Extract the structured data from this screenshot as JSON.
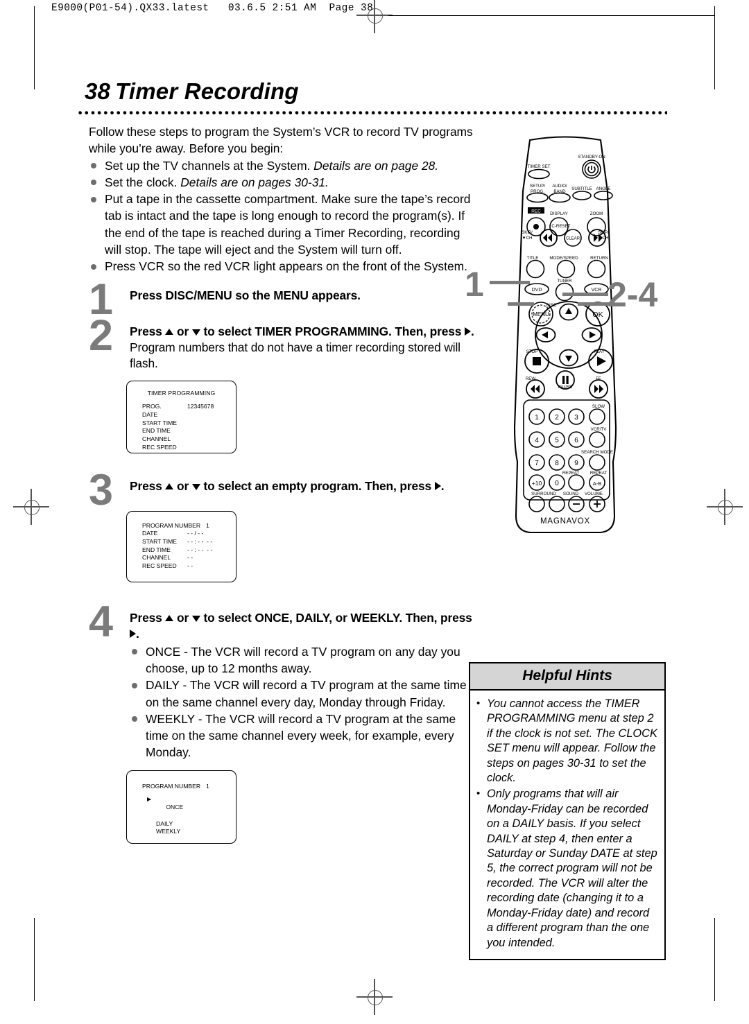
{
  "slug": "E9000(P01-54).QX33.latest   03.6.5 2:51 AM  Page 38",
  "title": {
    "number": "38",
    "text": "Timer Recording"
  },
  "intro": {
    "paragraph": "Follow these steps to program the System’s  VCR to record TV programs while you’re away. Before you begin:",
    "bullets": [
      {
        "text": "Set up the TV channels at the System. ",
        "italic": "Details are on page 28."
      },
      {
        "text": "Set the clock. ",
        "italic": "Details are on pages 30-31."
      },
      {
        "text": "Put a tape in the cassette compartment. Make sure the tape’s record tab is intact and the tape is long enough to record the program(s). If the end of the tape is reached during a Timer Recording, recording will stop. The tape will eject and the System will turn off.",
        "italic": ""
      },
      {
        "text": "Press VCR so the red VCR light appears on the front of the System.",
        "italic": ""
      }
    ]
  },
  "steps": [
    {
      "number": "1",
      "bold_a": "Press DISC/MENU so the MENU appears.",
      "regular_a": "",
      "bold_b": "",
      "regular_b": ""
    },
    {
      "number": "2",
      "bold_a": "Press ▲ or ▼ to select TIMER PROGRAMMING. Then, press ▶.",
      "regular_a": " Program numbers that do not have a timer recording stored will flash.",
      "bold_b": "",
      "regular_b": ""
    },
    {
      "number": "3",
      "bold_a": "Press ▲ or ▼ to select an empty program. Then, press ▶.",
      "regular_a": "",
      "bold_b": "",
      "regular_b": ""
    },
    {
      "number": "4",
      "bold_a": "Press ▲ or ▼ to select ONCE, DAILY, or WEEKLY. Then, press ▶.",
      "regular_a": "",
      "bold_b": "",
      "regular_b": ""
    }
  ],
  "step4_bullets": [
    "ONCE - The VCR will record a TV program on any day you choose, up to 12 months away.",
    "DAILY - The VCR will record a TV program at the same time on the same channel every day, Monday through Friday.",
    "WEEKLY - The VCR will record a TV program at the same time on the same channel every week, for example, every Monday."
  ],
  "osd": [
    {
      "title": "TIMER PROGRAMMING",
      "rows": [
        {
          "key": "PROG.",
          "value": "12345678"
        },
        {
          "key": "DATE",
          "value": ""
        },
        {
          "key": "START TIME",
          "value": ""
        },
        {
          "key": "END TIME",
          "value": ""
        },
        {
          "key": "CHANNEL",
          "value": ""
        },
        {
          "key": "REC SPEED",
          "value": ""
        }
      ],
      "options": []
    },
    {
      "title": "",
      "rows": [
        {
          "key": "PROGRAM NUMBER",
          "value": "1"
        },
        {
          "key": "DATE",
          "value": "- - / - -"
        },
        {
          "key": "START TIME",
          "value": "- - : - -  - -"
        },
        {
          "key": "END TIME",
          "value": "- - : - -  - -"
        },
        {
          "key": "CHANNEL",
          "value": "- -"
        },
        {
          "key": "REC SPEED",
          "value": "- -"
        }
      ],
      "options": []
    },
    {
      "title": "",
      "rows": [
        {
          "key": "PROGRAM NUMBER",
          "value": "1"
        }
      ],
      "options": [
        {
          "label": "ONCE",
          "selected": true
        },
        {
          "label": "DAILY",
          "selected": false
        },
        {
          "label": "WEEKLY",
          "selected": false
        }
      ]
    }
  ],
  "remote": {
    "brand": "MAGNAVOX",
    "callouts": [
      {
        "label": "1",
        "points_to": "DISC/MENU"
      },
      {
        "label": "2-4",
        "points_to": "navigation arrows"
      }
    ],
    "buttons": [
      "TIMER SET",
      "STANDBY-ON",
      "SETUP/ PROG.",
      "AUDIO/ BAND",
      "SUBTITLE",
      "ANGLE",
      "REC",
      "DISPLAY",
      "ZOOM",
      "SKIP/ ▼CH",
      "C-RESET CLEAR",
      "SKIP/ ▲CH",
      "TITLE",
      "MODE/SPEED",
      "RETURN",
      "TUNER",
      "DVD",
      "VCR",
      "DISC MENU",
      "OK",
      "STOP",
      "PLAY",
      "REW",
      "PAUSE",
      "FF",
      "1",
      "2",
      "3",
      "SLOW",
      "4",
      "5",
      "6",
      "VCR/TV",
      "7",
      "8",
      "9",
      "SEARCH MODE",
      "+10",
      "0",
      "REPEAT",
      "REPEAT A-B",
      "SURROUND",
      "SOUND",
      "VOLUME"
    ],
    "labels": {
      "timer_set": "TIMER SET",
      "standby_on": "STANDBY-ON",
      "setup_prog": "SETUP/",
      "setup_prog2": "PROG.",
      "audio_band": "AUDIO/",
      "audio_band2": "BAND",
      "subtitle": "SUBTITLE",
      "angle": "ANGLE",
      "rec": "REC",
      "display": "DISPLAY",
      "zoom": "ZOOM",
      "skip_down": "SKIP/",
      "skip_down2": "▼CH",
      "c_reset": "C-RESET",
      "clear": "CLEAR",
      "skip_up": "SKIP/",
      "skip_up2": "▲CH",
      "title": "TITLE",
      "mode_speed": "MODE/SPEED",
      "return": "RETURN",
      "tuner": "TUNER",
      "dvd": "DVD",
      "vcr": "VCR",
      "disc": "DISC",
      "menu": "MENU",
      "ok": "OK",
      "stop": "STOP",
      "play": "PLAY",
      "rew": "REW",
      "pause": "PAUSE",
      "ff": "FF",
      "slow": "SLOW",
      "vcrtv": "VCR/TV",
      "search_mode": "SEARCH MODE",
      "repeat": "REPEAT",
      "repeat_ab": "REPEAT",
      "ab": "A-B",
      "surround": "SURROUND",
      "sound": "SOUND",
      "volume": "VOLUME",
      "n1": "1",
      "n2": "2",
      "n3": "3",
      "n4": "4",
      "n5": "5",
      "n6": "6",
      "n7": "7",
      "n8": "8",
      "n9": "9",
      "n0": "0",
      "plus10": "+10"
    }
  },
  "hints": {
    "heading": "Helpful Hints",
    "items": [
      "You cannot access the TIMER PROGRAMMING menu at step 2 if the clock is not set. The CLOCK SET menu will appear. Follow the steps on pages 30-31 to set the clock.",
      "Only programs that will air Monday-Friday can be recorded on a DAILY basis. If you select DAILY at step 4, then enter a Saturday or Sunday DATE at step 5, the correct program will not be recorded. The VCR will alter the recording date (changing it to a Monday-Friday date) and record a different program than the one you intended."
    ]
  },
  "colors": {
    "step_number": "#7b7b7b",
    "bullet": "#6d6d6d",
    "hints_header_bg": "#d5d5d5"
  }
}
